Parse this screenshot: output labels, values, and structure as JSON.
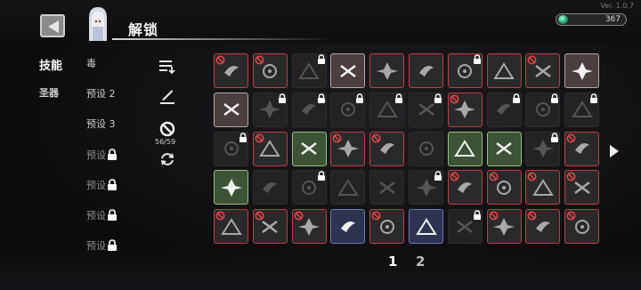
{
  "version": "Ver. 1.0.7",
  "header": {
    "title": "解锁"
  },
  "currency": {
    "value": "367",
    "icon": "green-gem-icon"
  },
  "tabs": [
    {
      "label": "技能"
    },
    {
      "label": "圣器"
    }
  ],
  "presets": [
    {
      "label": "毒",
      "locked": false
    },
    {
      "label": "预设 2",
      "locked": false
    },
    {
      "label": "预设 3",
      "locked": false
    },
    {
      "label": "预设",
      "locked": true
    },
    {
      "label": "预设",
      "locked": true
    },
    {
      "label": "预设",
      "locked": true
    },
    {
      "label": "预设",
      "locked": true
    }
  ],
  "tools": {
    "ban_count": "56/59",
    "icons": [
      "sort-icon",
      "sword-edit-icon",
      "ban-icon",
      "refresh-icon"
    ]
  },
  "pagination": {
    "pages": [
      "1",
      "2"
    ],
    "current": "1"
  },
  "grid": [
    [
      {
        "s": "red",
        "b": 1,
        "l": 0
      },
      {
        "s": "red",
        "b": 1,
        "l": 0
      },
      {
        "s": "dark",
        "b": 0,
        "l": 1
      },
      {
        "s": "lite",
        "b": 0,
        "l": 0
      },
      {
        "s": "red",
        "b": 0,
        "l": 0
      },
      {
        "s": "red",
        "b": 0,
        "l": 0
      },
      {
        "s": "red",
        "b": 0,
        "l": 1
      },
      {
        "s": "red",
        "b": 0,
        "l": 0
      },
      {
        "s": "red",
        "b": 1,
        "l": 0
      },
      {
        "s": "lite",
        "b": 0,
        "l": 0
      }
    ],
    [
      {
        "s": "lite",
        "b": 0,
        "l": 0
      },
      {
        "s": "dark",
        "b": 0,
        "l": 1
      },
      {
        "s": "dark",
        "b": 0,
        "l": 1
      },
      {
        "s": "dark",
        "b": 0,
        "l": 1
      },
      {
        "s": "dark",
        "b": 0,
        "l": 1
      },
      {
        "s": "dark",
        "b": 0,
        "l": 1
      },
      {
        "s": "red",
        "b": 1,
        "l": 0
      },
      {
        "s": "dark",
        "b": 0,
        "l": 1
      },
      {
        "s": "dark",
        "b": 0,
        "l": 1
      },
      {
        "s": "dark",
        "b": 0,
        "l": 1
      }
    ],
    [
      {
        "s": "dark",
        "b": 0,
        "l": 1
      },
      {
        "s": "red",
        "b": 1,
        "l": 0
      },
      {
        "s": "green",
        "b": 0,
        "l": 0
      },
      {
        "s": "red",
        "b": 1,
        "l": 0
      },
      {
        "s": "red",
        "b": 1,
        "l": 0
      },
      {
        "s": "dark",
        "b": 0,
        "l": 0
      },
      {
        "s": "green",
        "b": 0,
        "l": 0
      },
      {
        "s": "green",
        "b": 0,
        "l": 0
      },
      {
        "s": "dark",
        "b": 0,
        "l": 1
      },
      {
        "s": "red",
        "b": 1,
        "l": 0
      }
    ],
    [
      {
        "s": "green",
        "b": 0,
        "l": 0
      },
      {
        "s": "dark",
        "b": 0,
        "l": 0
      },
      {
        "s": "dark",
        "b": 0,
        "l": 1
      },
      {
        "s": "dark",
        "b": 0,
        "l": 0
      },
      {
        "s": "dark",
        "b": 0,
        "l": 0
      },
      {
        "s": "dark",
        "b": 0,
        "l": 1
      },
      {
        "s": "red",
        "b": 1,
        "l": 0
      },
      {
        "s": "red",
        "b": 1,
        "l": 0
      },
      {
        "s": "red",
        "b": 1,
        "l": 0
      },
      {
        "s": "red",
        "b": 1,
        "l": 0
      }
    ],
    [
      {
        "s": "red",
        "b": 1,
        "l": 0
      },
      {
        "s": "red",
        "b": 1,
        "l": 0
      },
      {
        "s": "red",
        "b": 1,
        "l": 0
      },
      {
        "s": "blue",
        "b": 0,
        "l": 0
      },
      {
        "s": "red",
        "b": 1,
        "l": 0
      },
      {
        "s": "blue",
        "b": 0,
        "l": 0
      },
      {
        "s": "dark",
        "b": 0,
        "l": 1
      },
      {
        "s": "red",
        "b": 1,
        "l": 0
      },
      {
        "s": "red",
        "b": 1,
        "l": 0
      },
      {
        "s": "red",
        "b": 1,
        "l": 0
      }
    ]
  ]
}
